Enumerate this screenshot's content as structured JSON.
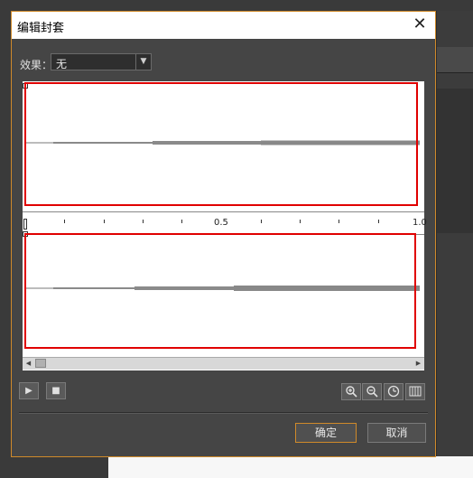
{
  "dialog": {
    "title": "编辑封套",
    "effect_label": "效果：",
    "effect_value": "无",
    "ruler_labels": [
      "0.5",
      "1.0"
    ],
    "ok_label": "确定",
    "cancel_label": "取消"
  },
  "colors": {
    "accent": "#d08a2a",
    "highlight_box": "#e00000"
  },
  "icons": {
    "play": "play-icon",
    "stop": "stop-icon",
    "zoom_in": "zoom-in-icon",
    "zoom_out": "zoom-out-icon",
    "zoom_reset": "clock-icon",
    "full_view": "columns-icon"
  }
}
